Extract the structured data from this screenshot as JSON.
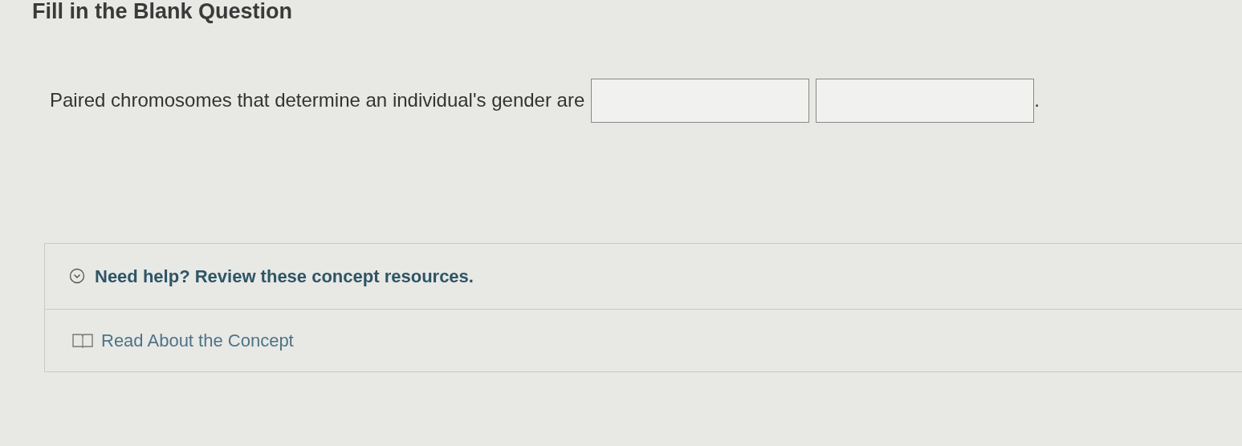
{
  "title": "Fill in the Blank Question",
  "question": {
    "text": "Paired chromosomes that determine an individual's gender are",
    "blanks": [
      {
        "kind": "text"
      },
      {
        "kind": "text"
      }
    ],
    "end": "."
  },
  "help": {
    "label": "Need help? Review these concept resources.",
    "expanded": true,
    "resources": [
      {
        "label": "Read About the Concept"
      }
    ]
  }
}
